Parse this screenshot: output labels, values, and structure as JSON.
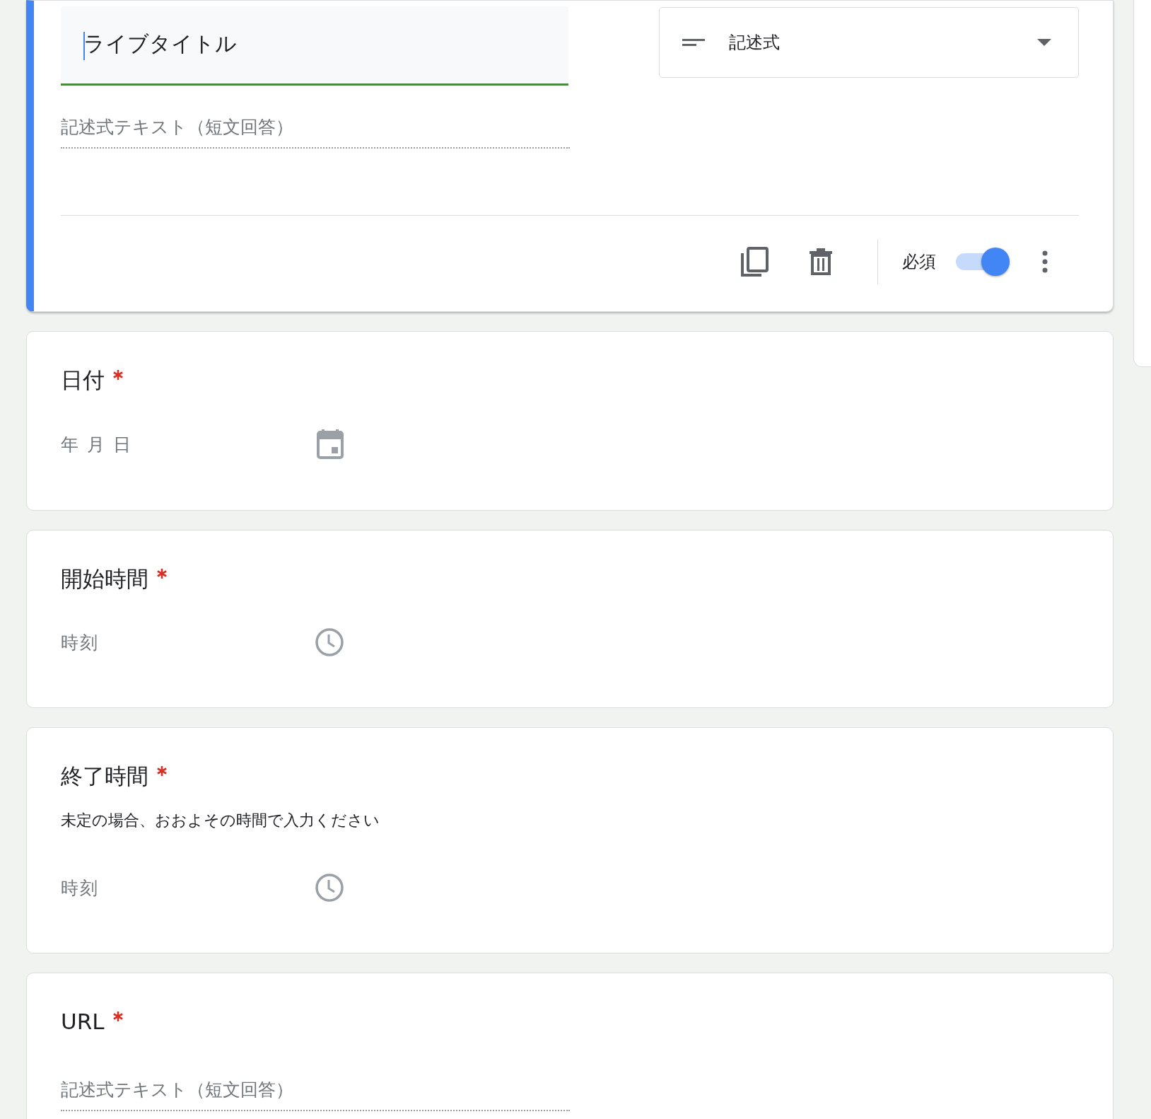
{
  "active_question": {
    "title": "ライブタイトル",
    "type_dropdown": {
      "label": "記述式"
    },
    "answer_placeholder": "記述式テキスト（短文回答）",
    "required_label": "必須",
    "required": true
  },
  "questions": [
    {
      "kind": "date",
      "title": "日付",
      "required": true,
      "field_label": "年 月 日"
    },
    {
      "kind": "time",
      "title": "開始時間",
      "required": true,
      "field_label": "時刻"
    },
    {
      "kind": "time",
      "title": "終了時間",
      "required": true,
      "description": "未定の場合、おおよその時間で入力ください",
      "field_label": "時刻"
    },
    {
      "kind": "short_text",
      "title": "URL",
      "required": true,
      "field_label": "記述式テキスト（短文回答）"
    }
  ]
}
